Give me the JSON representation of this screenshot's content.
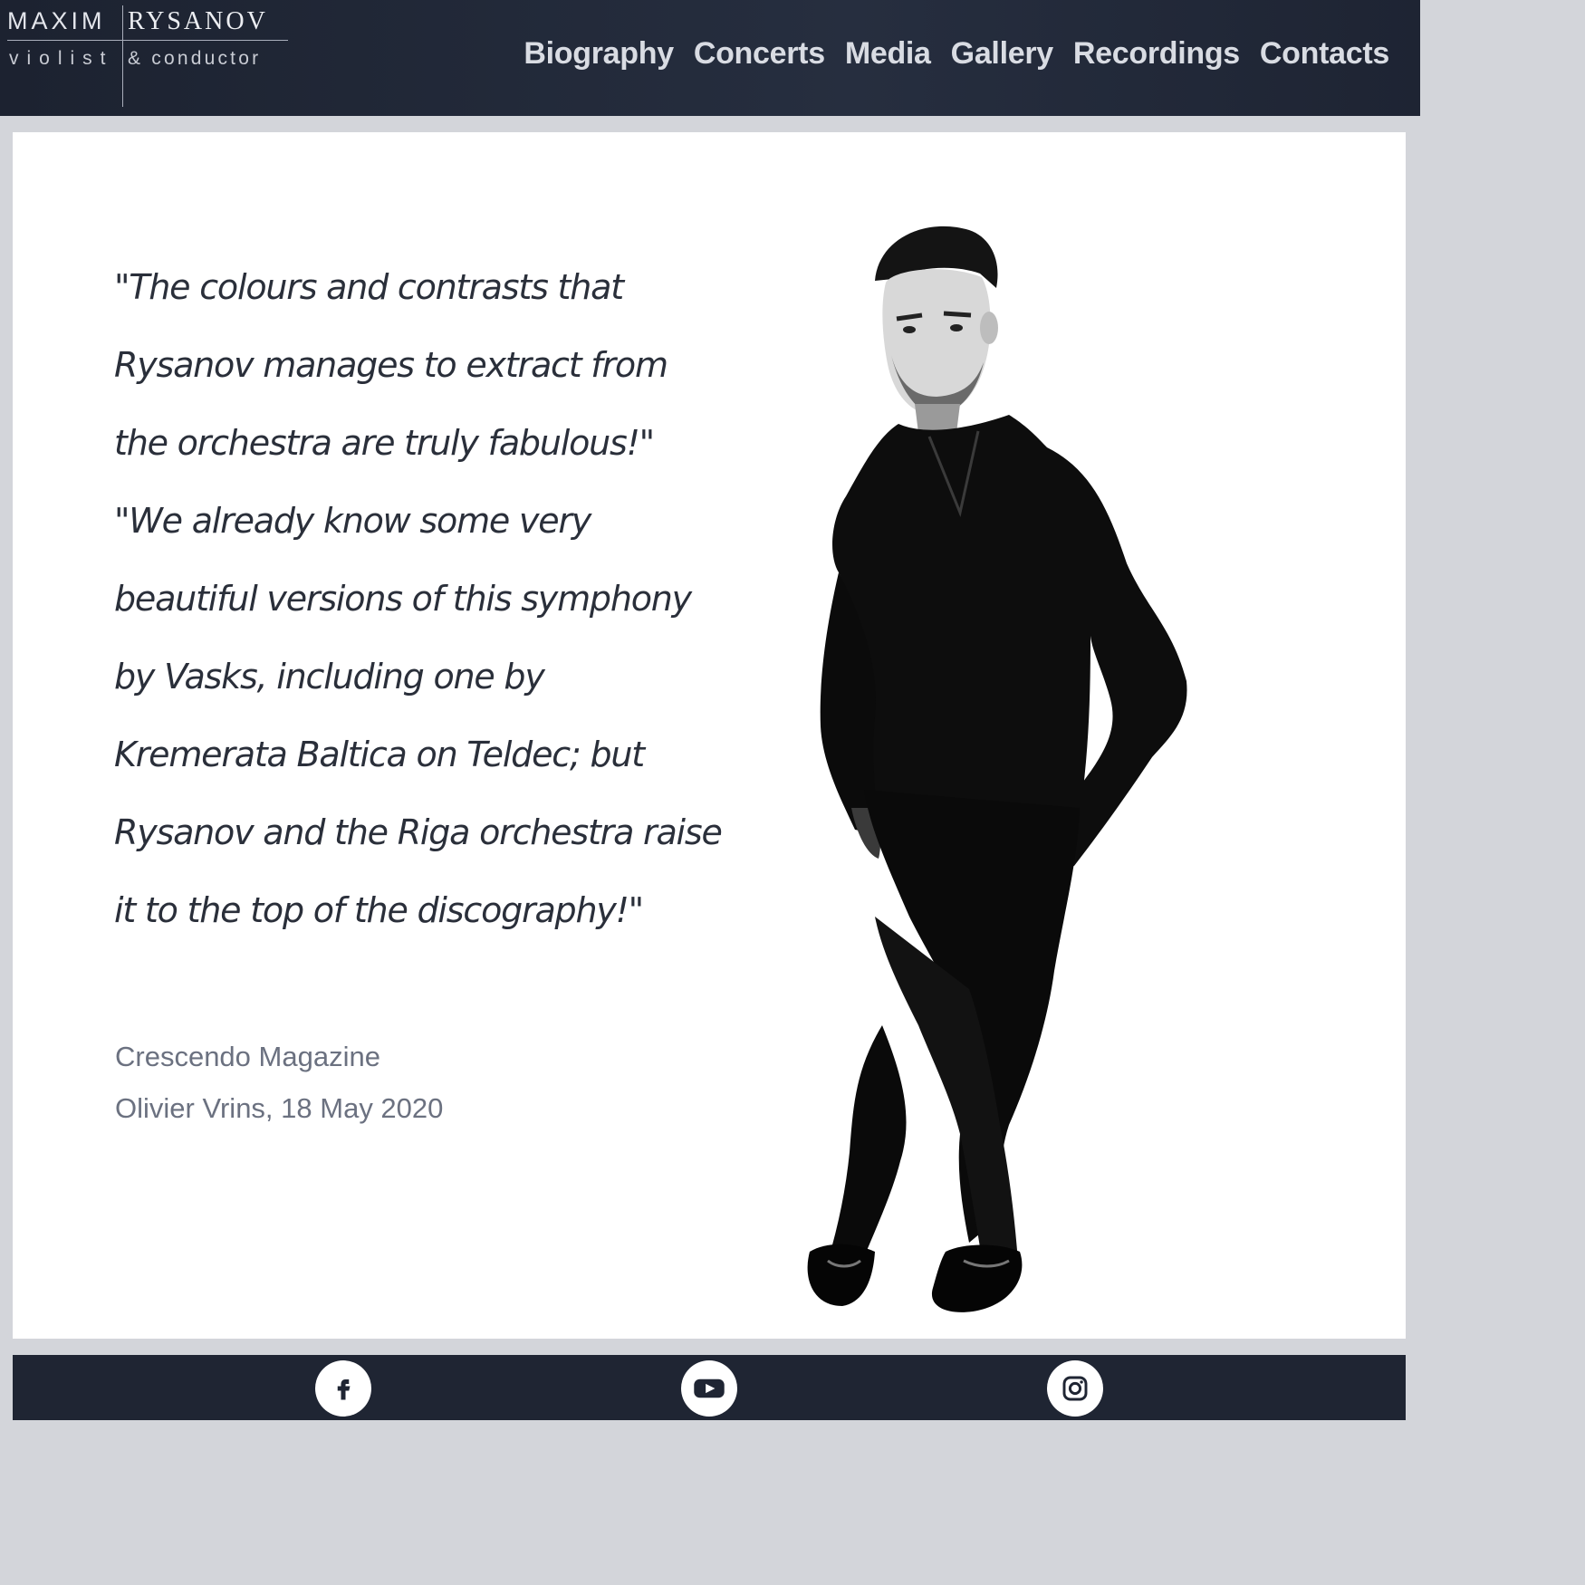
{
  "logo": {
    "first_name": "MAXIM",
    "last_name": "RYSANOV",
    "role_left": "violist",
    "role_right": "& conductor"
  },
  "nav": {
    "items": [
      {
        "label": "Biography"
      },
      {
        "label": "Concerts"
      },
      {
        "label": "Media"
      },
      {
        "label": "Gallery"
      },
      {
        "label": "Recordings"
      },
      {
        "label": "Contacts"
      }
    ]
  },
  "quote": {
    "lines": [
      "\"The colours and contrasts that",
      "Rysanov manages to extract from",
      "the orchestra are truly fabulous!\"",
      "\"We already know some very",
      "beautiful versions of this symphony",
      "by Vasks, including one by",
      "Kremerata Baltica on Teldec; but",
      "Rysanov and the Riga orchestra raise",
      "it to the top of the discography!\""
    ],
    "source": "Crescendo Magazine",
    "author_date": "Olivier Vrins, 18 May 2020"
  },
  "footer": {
    "icons": [
      "facebook-icon",
      "youtube-icon",
      "instagram-icon"
    ]
  },
  "colors": {
    "header_bg": "#232a3a",
    "nav_text": "#d9dce3",
    "quote_text": "#2a2f3a",
    "credit_text": "#6b7180",
    "footer_bg": "#1f2533"
  }
}
